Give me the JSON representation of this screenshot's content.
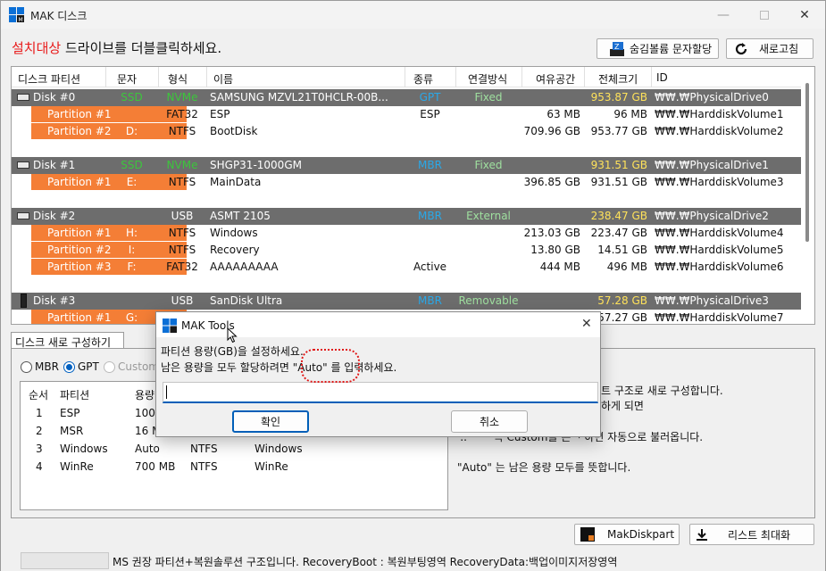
{
  "window": {
    "title": "MAK 디스크"
  },
  "header": {
    "instruction_red": "설치대상",
    "instruction_rest": "드라이브를 더블클릭하세요.",
    "assign_button": "숨김볼륨 문자할당",
    "refresh_button": "새로고침"
  },
  "grid": {
    "columns": [
      "디스크 파티션",
      "문자",
      "형식",
      "이름",
      "종류",
      "연결방식",
      "여유공간",
      "전체크기",
      "ID"
    ],
    "rows": [
      {
        "kind": "disk",
        "icon": "hdd-icon",
        "cells": [
          "Disk #0",
          "SSD",
          "NVMe",
          "SAMSUNG MZVL21T0HCLR-00B...",
          "GPT",
          "Fixed",
          "",
          "953.87 GB",
          "₩₩.₩PhysicalDrive0"
        ]
      },
      {
        "kind": "part",
        "cells": [
          "Partition #1",
          "",
          "FAT32",
          "ESP",
          "ESP",
          "",
          "63 MB",
          "96 MB",
          "₩₩.₩HarddiskVolume1"
        ]
      },
      {
        "kind": "part",
        "cells": [
          "Partition #2",
          "D:",
          "NTFS",
          "BootDisk",
          "",
          "",
          "709.96 GB",
          "953.77 GB",
          "₩₩.₩HarddiskVolume2"
        ]
      },
      {
        "kind": "blank"
      },
      {
        "kind": "disk",
        "icon": "hdd-icon",
        "cells": [
          "Disk #1",
          "SSD",
          "NVMe",
          " SHGP31-1000GM",
          "MBR",
          "Fixed",
          "",
          "931.51 GB",
          "₩₩.₩PhysicalDrive1"
        ]
      },
      {
        "kind": "part",
        "cells": [
          "Partition #1",
          "E:",
          "NTFS",
          "MainData",
          "",
          "",
          "396.85 GB",
          "931.51 GB",
          "₩₩.₩HarddiskVolume3"
        ]
      },
      {
        "kind": "blank"
      },
      {
        "kind": "disk",
        "icon": "usb-icon",
        "cells": [
          "Disk #2",
          "",
          "USB",
          "ASMT 2105",
          "MBR",
          "External",
          "",
          "238.47 GB",
          "₩₩.₩PhysicalDrive2"
        ]
      },
      {
        "kind": "part",
        "cells": [
          "Partition #1",
          "H:",
          "NTFS",
          "Windows",
          "",
          "",
          "213.03 GB",
          "223.47 GB",
          "₩₩.₩HarddiskVolume4"
        ]
      },
      {
        "kind": "part",
        "cells": [
          "Partition #2",
          "I:",
          "NTFS",
          "Recovery",
          "",
          "",
          "13.80 GB",
          "14.51 GB",
          "₩₩.₩HarddiskVolume5"
        ]
      },
      {
        "kind": "part",
        "cells": [
          "Partition #3",
          "F:",
          "FAT32",
          "AAAAAAAAA",
          "Active",
          "",
          "444 MB",
          "496 MB",
          "₩₩.₩HarddiskVolume6"
        ]
      },
      {
        "kind": "blank"
      },
      {
        "kind": "disk",
        "icon": "usb-stick-icon",
        "cells": [
          "Disk #3",
          "",
          "USB",
          "SanDisk Ultra",
          "MBR",
          "Removable",
          "",
          "57.28 GB",
          "₩₩.₩PhysicalDrive3"
        ]
      },
      {
        "kind": "part",
        "cells": [
          "Partition #1",
          "G:",
          "",
          "",
          "",
          "",
          "",
          "57.27 GB",
          "₩₩.₩HarddiskVolume7"
        ]
      }
    ]
  },
  "colors": {
    "ssd": "#3cc63c",
    "nvme": "#3cc63c",
    "scheme": "#2aa8e8",
    "conn": "#9fe09f",
    "total": "#ffe25a",
    "partition_bg": "#f47e36",
    "disk_row_bg": "#6d6d6d"
  },
  "panel": {
    "tab_label": "디스크 새로 구성하기",
    "radios": [
      "MBR",
      "GPT",
      "Custom"
    ],
    "selected_radio": "GPT",
    "plan_columns": [
      "순서",
      "파티션",
      "용량"
    ],
    "plan_rows": [
      [
        "1",
        "ESP",
        "100",
        "",
        ""
      ],
      [
        "2",
        "MSR",
        "16 M",
        "",
        ""
      ],
      [
        "3",
        "Windows",
        "Auto",
        "NTFS",
        "Windows"
      ],
      [
        "4",
        "WinRe",
        "700 MB",
        "NTFS",
        "WinRe"
      ]
    ],
    "info": [
      "트 구조로 새로 구성합니다.",
      "하게 되면",
      "'.. ᄃᄂ ᆨ Custom을 는 ᅮ하면 자동으로 불러옵니다.",
      "\"Auto\" 는 남은 용량 모두를 뜻합니다."
    ]
  },
  "footer": {
    "makdiskpart": "MakDiskpart",
    "maximize_list": "리스트 최대화",
    "status": "MS 권장 파티션+복원솔루션 구조입니다. RecoveryBoot : 복원부팅영역 RecoveryData:백업이미지저장영역"
  },
  "dialog": {
    "title": "MAK Tools",
    "line1": "파티션 용량(GB)을 설정하세요.",
    "line2": "남은 용량을 모두 할당하려면 \"Auto\" 를 입력하세요.",
    "input_value": "",
    "ok": "확인",
    "cancel": "취소"
  }
}
